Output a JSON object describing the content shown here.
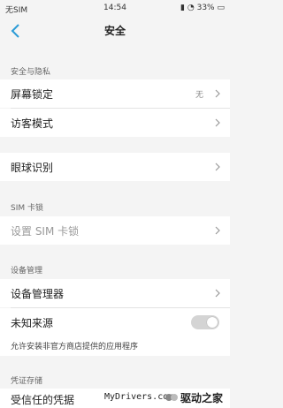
{
  "status": {
    "carrier": "无SIM",
    "time": "14:54",
    "battery": "33%"
  },
  "nav": {
    "title": "安全"
  },
  "sections": {
    "privacy_header": "安全与隐私",
    "screen_lock": {
      "label": "屏幕锁定",
      "value": "无"
    },
    "guest_mode": {
      "label": "访客模式"
    },
    "eye_recognition": {
      "label": "眼球识别"
    },
    "sim_header": "SIM 卡锁",
    "sim_lock": {
      "label": "设置 SIM 卡锁"
    },
    "device_header": "设备管理",
    "device_manager": {
      "label": "设备管理器"
    },
    "unknown_sources": {
      "label": "未知来源",
      "enabled": false,
      "description": "允许安装非官方商店提供的应用程序"
    },
    "credential_header": "凭证存储",
    "trusted_credentials": {
      "label": "受信任的凭据"
    }
  },
  "watermark": {
    "site": "MyDrivers.com",
    "brand": "驱动之家"
  },
  "colors": {
    "accent": "#2a9bd6",
    "chevron": "#9a9a9a",
    "disabled_text": "#9a9a9a"
  }
}
